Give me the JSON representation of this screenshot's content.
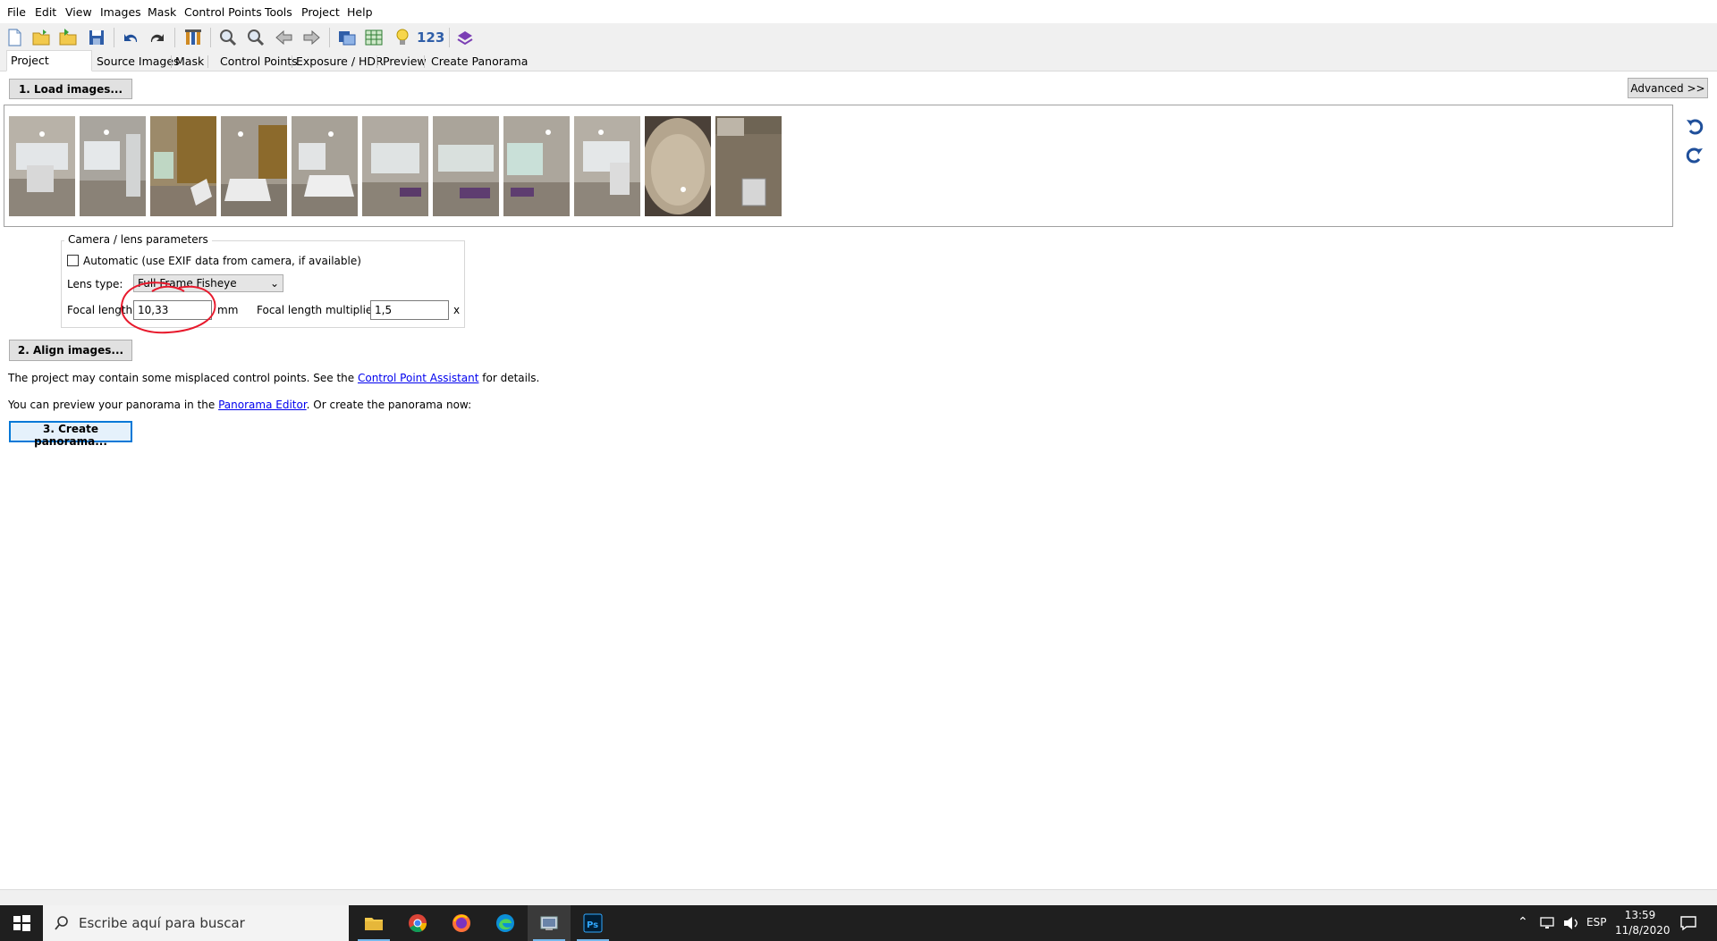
{
  "menu": [
    "File",
    "Edit",
    "View",
    "Images",
    "Mask",
    "Control Points",
    "Tools",
    "Project",
    "Help"
  ],
  "toolbar": {
    "icons": [
      "new-file-icon",
      "open-folder-icon",
      "open-recent-icon",
      "save-icon",
      "undo-icon",
      "redo-icon",
      "pano-info-icon",
      "zoom-in-icon",
      "zoom-out-icon",
      "previous-image-icon",
      "next-image-icon",
      "fast-preview-icon",
      "table-icon",
      "lightbulb-icon",
      "control-point-count-icon",
      "layout-icon"
    ],
    "counter_label": "123"
  },
  "tabs": [
    "Project Assistant",
    "Source Images",
    "Mask",
    "Control Points",
    "Exposure / HDR",
    "Preview",
    "Create Panorama"
  ],
  "load_button": "1. Load images...",
  "advanced_button": "Advanced >>",
  "thumbnails": [
    "image-1",
    "image-2",
    "image-3",
    "image-4",
    "image-5",
    "image-6",
    "image-7",
    "image-8",
    "image-9",
    "image-10",
    "image-11"
  ],
  "camera": {
    "group_title": "Camera / lens parameters",
    "automatic_label": "Automatic (use EXIF data from camera, if available)",
    "lens_type_label": "Lens type:",
    "lens_type_value": "Full Frame Fisheye",
    "focal_length_label": "Focal length:",
    "focal_length_value": "10,33",
    "focal_length_unit": "mm",
    "multiplier_label": "Focal length multiplier:",
    "multiplier_value": "1,5",
    "multiplier_unit": "x"
  },
  "align_button": "2. Align images...",
  "message1": {
    "before": "The project may contain some misplaced control points. See the ",
    "link": "Control Point Assistant",
    "after": " for details."
  },
  "message2": {
    "before": "You can preview your panorama in the ",
    "link": "Panorama Editor",
    "after": ". Or create the panorama now:"
  },
  "create_button": "3. Create panorama...",
  "taskbar": {
    "search_placeholder": "Escribe aquí para buscar",
    "language": "ESP",
    "time": "13:59",
    "date": "11/8/2020"
  },
  "colors": {
    "accent": "#0078d7",
    "link": "#0000ee",
    "annotation": "#e8192c"
  }
}
